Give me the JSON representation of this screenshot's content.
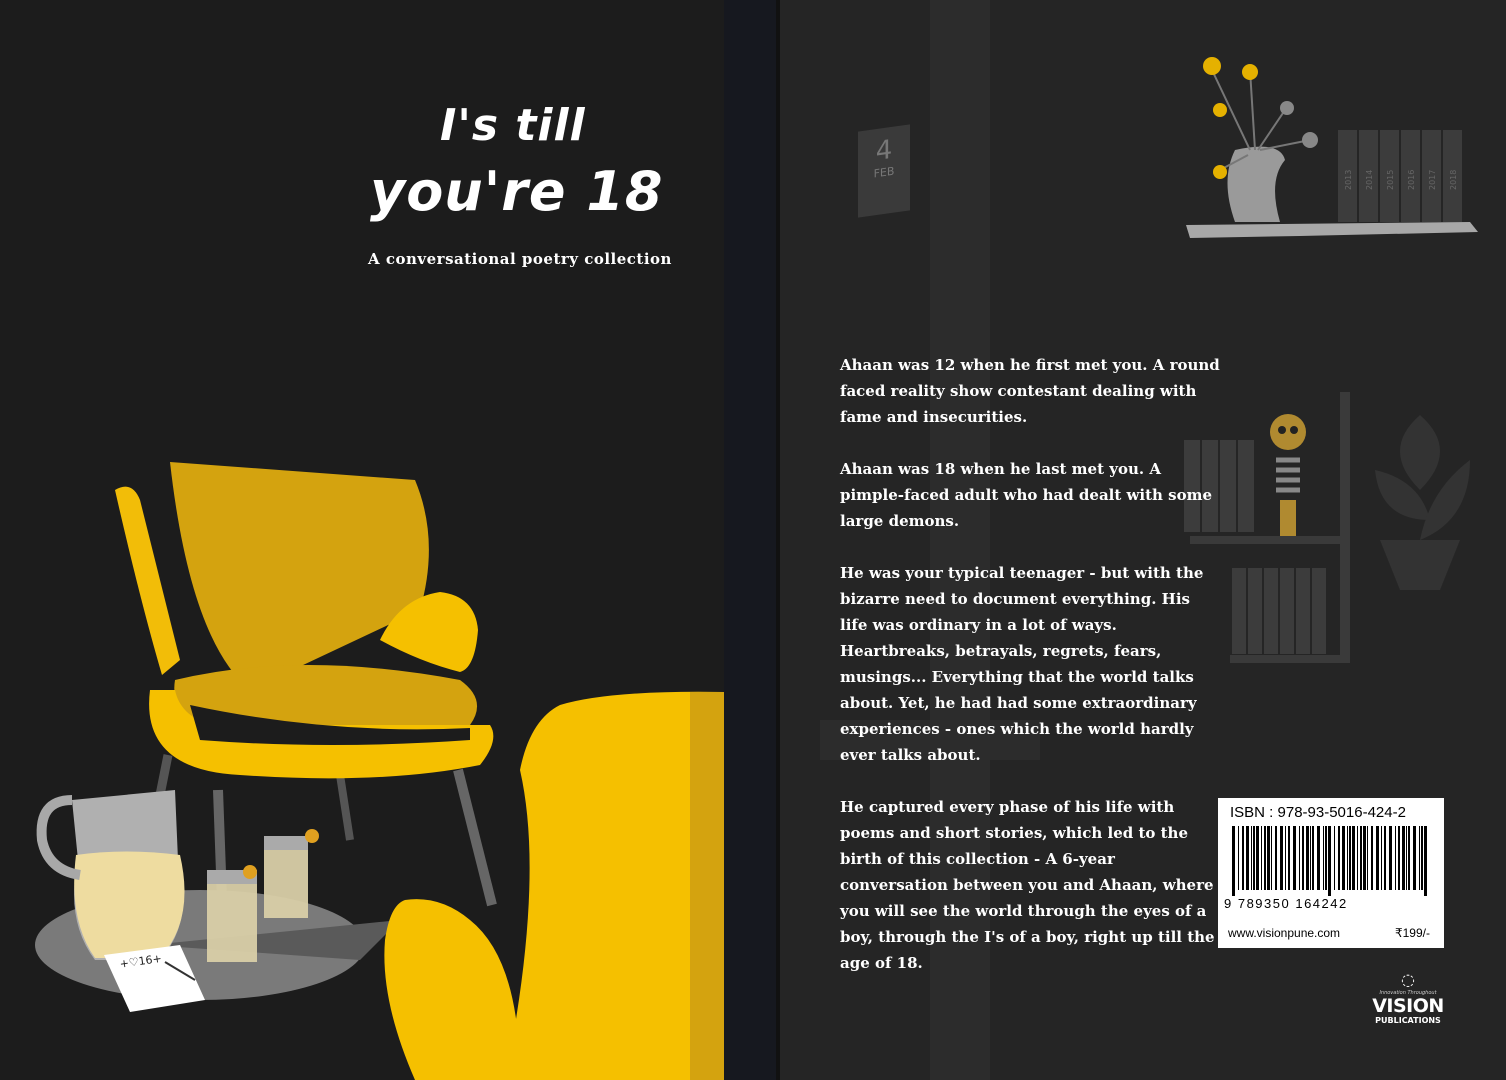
{
  "front": {
    "title_line1": "I's till",
    "title_line2": "you're 18",
    "subtitle": "A conversational poetry collection",
    "note_text": "+♡16+"
  },
  "back": {
    "calendar_day": "4",
    "calendar_month": "FEB",
    "book_years": [
      "2013",
      "2014",
      "2015",
      "2016",
      "2017",
      "2018"
    ],
    "blurb": [
      "Ahaan was 12 when he first met you. A round faced reality show contestant dealing with fame and insecurities.",
      "Ahaan was 18 when he last met you. A pimple-faced adult who had dealt with some large demons.",
      "He was your typical teenager - but with the bizarre need to document everything. His life was ordinary in a lot of ways. Heartbreaks, betrayals, regrets, fears, musings... Everything that the world talks about. Yet, he had had some extraordinary experiences - ones which the world hardly ever talks about.",
      "He captured every phase of his life with poems and short stories, which led to the birth of this collection - A 6-year conversation between you and Ahaan, where you will see the world through the eyes of a boy, through the I's of a boy, right up till the age of 18."
    ],
    "isbn_label": "ISBN : 978-93-5016-424-2",
    "isbn_digits": "9 789350 164242",
    "website": "www.visionpune.com",
    "price": "₹199/-",
    "publisher_tagline": "Innovation Throughout",
    "publisher_name": "VISION",
    "publisher_sub": "PUBLICATIONS"
  },
  "colors": {
    "background": "#1c1c1c",
    "accent_yellow": "#f5c000",
    "accent_dark_yellow": "#d4a30f",
    "text": "#ffffff"
  }
}
